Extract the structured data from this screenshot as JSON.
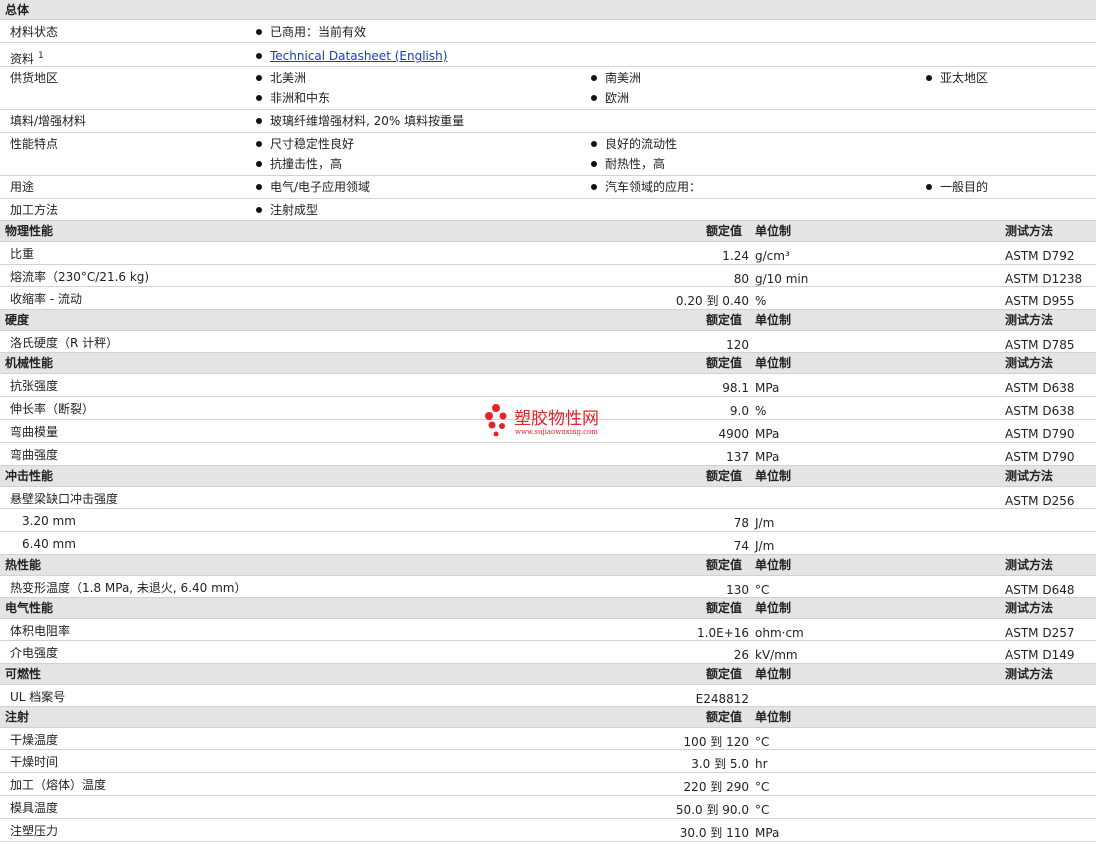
{
  "general": {
    "title": "总体",
    "status": {
      "label": "材料状态",
      "value": "已商用：当前有效"
    },
    "docs": {
      "label": "资料",
      "sup": "1",
      "value": "Technical Datasheet (English)"
    },
    "regions": {
      "label": "供货地区",
      "items": [
        "北美洲",
        "南美洲",
        "亚太地区",
        "非洲和中东",
        "欧洲"
      ]
    },
    "filler": {
      "label": "填料/增强材料",
      "value": "玻璃纤维增强材料, 20% 填料按重量"
    },
    "features": {
      "label": "性能特点",
      "items": [
        "尺寸稳定性良好",
        "良好的流动性",
        "抗撞击性，高",
        "耐热性，高"
      ]
    },
    "uses": {
      "label": "用途",
      "items": [
        "电气/电子应用领域",
        "汽车领域的应用：",
        "一般目的"
      ]
    },
    "processing": {
      "label": "加工方法",
      "items": [
        "注射成型"
      ]
    }
  },
  "headers": {
    "value": "额定值",
    "unit": "单位制",
    "method": "测试方法"
  },
  "sections": {
    "physical": {
      "title": "物理性能",
      "rows": [
        {
          "name": "比重",
          "value": "1.24",
          "unit": "g/cm³",
          "method": "ASTM D792"
        },
        {
          "name": "熔流率（230°C/21.6 kg)",
          "value": "80",
          "unit": "g/10 min",
          "method": "ASTM D1238"
        },
        {
          "name": "收缩率 - 流动",
          "value": "0.20 到  0.40",
          "unit": "%",
          "method": "ASTM D955"
        }
      ]
    },
    "hardness": {
      "title": "硬度",
      "rows": [
        {
          "name": "洛氏硬度（R 计秤）",
          "value": "120",
          "unit": "",
          "method": "ASTM D785"
        }
      ]
    },
    "mechanical": {
      "title": "机械性能",
      "rows": [
        {
          "name": "抗张强度",
          "value": "98.1",
          "unit": "MPa",
          "method": "ASTM D638"
        },
        {
          "name": "伸长率（断裂）",
          "value": "9.0",
          "unit": "%",
          "method": "ASTM D638"
        },
        {
          "name": "弯曲模量",
          "value": "4900",
          "unit": "MPa",
          "method": "ASTM D790"
        },
        {
          "name": "弯曲强度",
          "value": "137",
          "unit": "MPa",
          "method": "ASTM D790"
        }
      ]
    },
    "impact": {
      "title": "冲击性能",
      "rows": [
        {
          "name": "悬壁梁缺口冲击强度",
          "value": "",
          "unit": "",
          "method": "ASTM D256"
        },
        {
          "name": "3.20 mm",
          "value": "78",
          "unit": "J/m",
          "method": ""
        },
        {
          "name": "6.40 mm",
          "value": "74",
          "unit": "J/m",
          "method": ""
        }
      ]
    },
    "thermal": {
      "title": "热性能",
      "rows": [
        {
          "name": "热变形温度（1.8 MPa, 未退火, 6.40 mm）",
          "value": "130",
          "unit": "°C",
          "method": "ASTM D648"
        }
      ]
    },
    "electrical": {
      "title": "电气性能",
      "rows": [
        {
          "name": "体积电阻率",
          "value": "1.0E+16",
          "unit": "ohm·cm",
          "method": "ASTM D257"
        },
        {
          "name": "介电强度",
          "value": "26",
          "unit": "kV/mm",
          "method": "ASTM D149"
        }
      ]
    },
    "flammability": {
      "title": "可燃性",
      "rows": [
        {
          "name": "UL 档案号",
          "value": "E248812",
          "unit": "",
          "method": ""
        }
      ]
    },
    "injection": {
      "title": "注射",
      "rows": [
        {
          "name": "干燥温度",
          "value": "100 到  120",
          "unit": "°C",
          "method": ""
        },
        {
          "name": "干燥时间",
          "value": "3.0 到  5.0",
          "unit": "hr",
          "method": ""
        },
        {
          "name": "加工（熔体）温度",
          "value": "220 到  290",
          "unit": "°C",
          "method": ""
        },
        {
          "name": "模具温度",
          "value": "50.0 到  90.0",
          "unit": "°C",
          "method": ""
        },
        {
          "name": "注塑压力",
          "value": "30.0 到  110",
          "unit": "MPa",
          "method": ""
        }
      ]
    }
  },
  "watermark": {
    "text": "塑胶物性网",
    "url": "www.sujiaowuxing.com",
    "dot_color": "#e8202a",
    "text_color": "#e8202a"
  }
}
